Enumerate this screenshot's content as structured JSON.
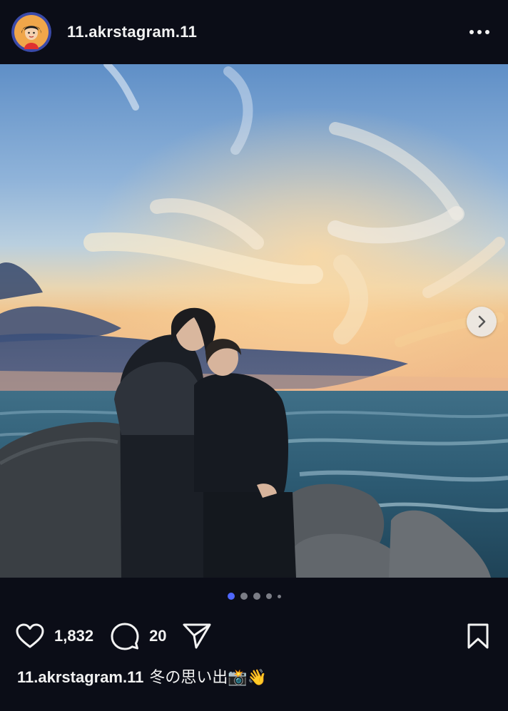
{
  "post": {
    "username": "11.akrstagram.11",
    "likes": "1,832",
    "comments": "20",
    "caption": {
      "username": "11.akrstagram.11",
      "text": "冬の思い出📸👋"
    }
  },
  "carousel": {
    "total_slides": 5,
    "current_slide": 1
  },
  "icons": {
    "more": "more-horizontal-icon",
    "next": "chevron-right-icon",
    "like": "heart-outline-icon",
    "comment": "comment-bubble-icon",
    "share": "paper-plane-icon",
    "save": "bookmark-outline-icon"
  },
  "colors": {
    "background": "#0b0d17",
    "accent_dot": "#4f67ff",
    "text": "#f2f2f2"
  }
}
